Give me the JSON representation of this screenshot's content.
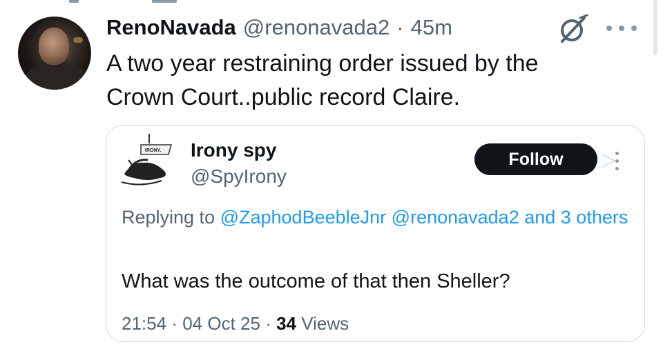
{
  "tweet": {
    "display_name": "RenoNavada",
    "handle": "@renonavada2",
    "separator": "·",
    "time": "45m",
    "text_line1": "A two year restraining order issued by the",
    "text_line2": "Crown Court..public record Claire."
  },
  "quote": {
    "display_name": "Irony spy",
    "handle": "@SpyIrony",
    "follow_label": "Follow",
    "replying_prefix": "Replying to ",
    "mention1": "@ZaphodBeebleJnr",
    "mention2": "@renonavada2",
    "and_others": "and 3 others",
    "text": "What was the outcome of that then Sheller?",
    "time": "21:54",
    "separator": "·",
    "date": "04 Oct 25",
    "views_count": "34",
    "views_label": "Views"
  },
  "icons": {
    "grok": "grok-icon",
    "more": "more-icon"
  },
  "colors": {
    "text": "#0f1419",
    "secondary": "#536471",
    "link": "#1d9bf0",
    "border": "#cfd9de",
    "button_bg": "#0f1419"
  }
}
